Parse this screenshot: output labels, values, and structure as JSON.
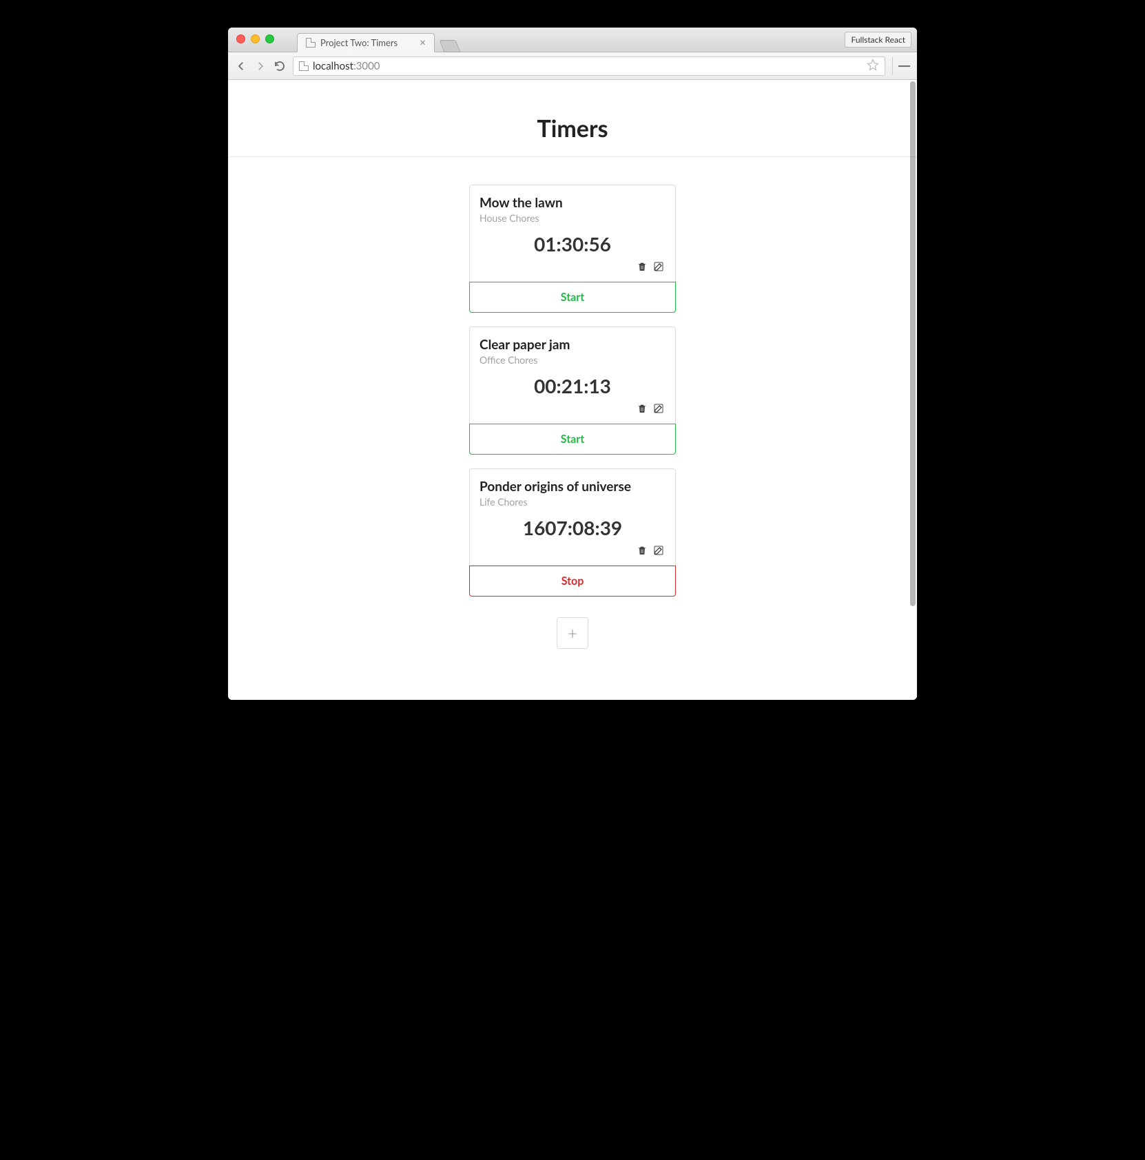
{
  "browser": {
    "tab_title": "Project Two: Timers",
    "extension_button": "Fullstack React",
    "url_host": "localhost",
    "url_port": ":3000"
  },
  "page": {
    "heading": "Timers",
    "add_label": "+"
  },
  "timers": [
    {
      "title": "Mow the lawn",
      "project": "House Chores",
      "elapsed": "01:30:56",
      "action": "start",
      "action_label": "Start"
    },
    {
      "title": "Clear paper jam",
      "project": "Office Chores",
      "elapsed": "00:21:13",
      "action": "start",
      "action_label": "Start"
    },
    {
      "title": "Ponder origins of universe",
      "project": "Life Chores",
      "elapsed": "1607:08:39",
      "action": "stop",
      "action_label": "Stop"
    }
  ]
}
